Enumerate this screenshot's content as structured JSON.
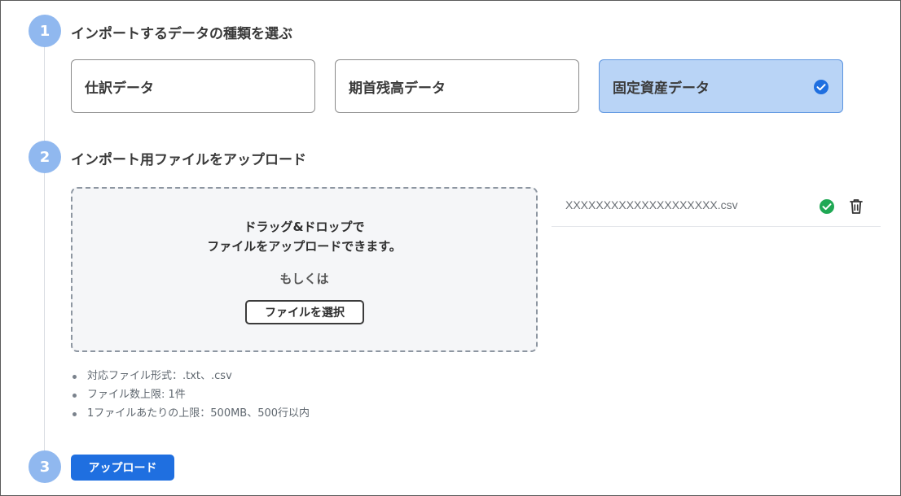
{
  "steps": [
    {
      "number": "1",
      "title": "インポートするデータの種類を選ぶ"
    },
    {
      "number": "2",
      "title": "インポート用ファイルをアップロード"
    },
    {
      "number": "3",
      "title": ""
    }
  ],
  "data_types": [
    {
      "label": "仕訳データ",
      "selected": false
    },
    {
      "label": "期首残高データ",
      "selected": false
    },
    {
      "label": "固定資産データ",
      "selected": true
    }
  ],
  "dropzone": {
    "line1": "ドラッグ&ドロップで",
    "line2": "ファイルをアップロードできます。",
    "or_text": "もしくは",
    "select_button": "ファイルを選択"
  },
  "notes": [
    "対応ファイル形式：.txt、.csv",
    "ファイル数上限: 1件",
    "1ファイルあたりの上限：500MB、500行以内"
  ],
  "uploaded_file": {
    "name": "XXXXXXXXXXXXXXXXXXXX.csv",
    "status_icon": "check-circle-icon",
    "delete_icon": "trash-icon"
  },
  "upload_button": "アップロード",
  "colors": {
    "accent": "#1f6fe0",
    "step_circle": "#90b8ef",
    "selected_card": "#b9d4f6",
    "success": "#1fa854"
  }
}
